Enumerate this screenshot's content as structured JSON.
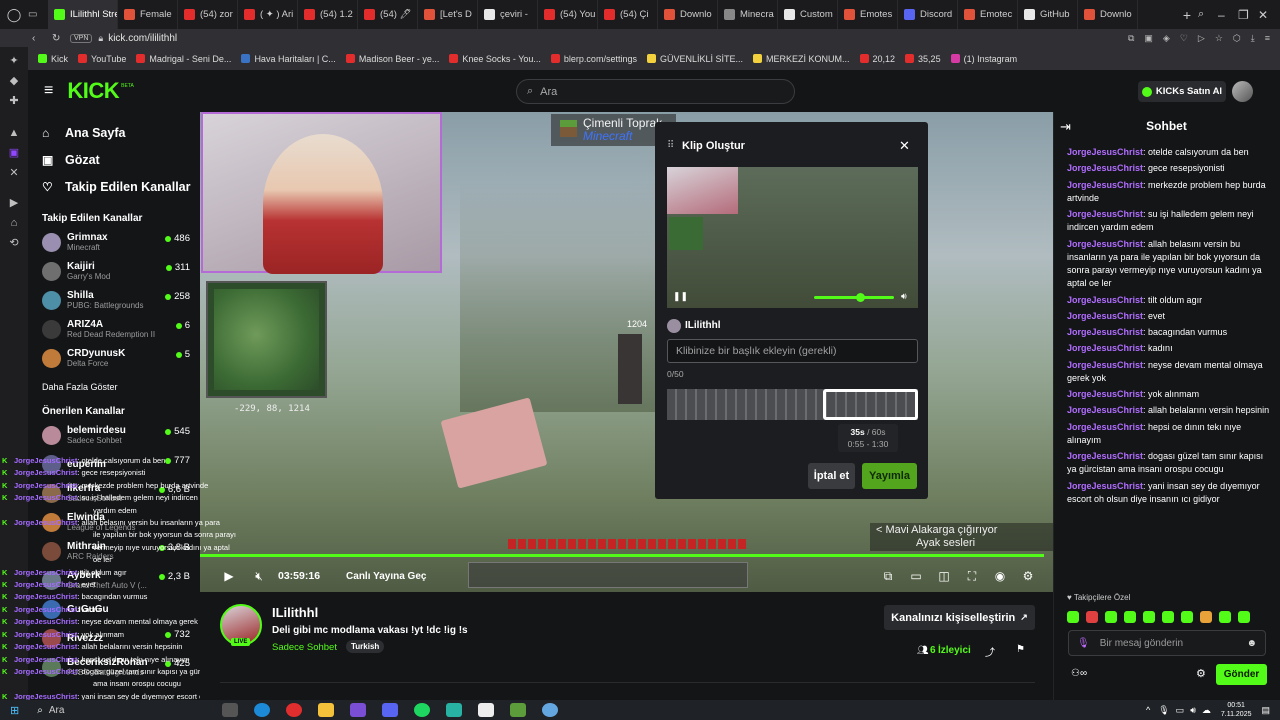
{
  "browser": {
    "tabs": [
      {
        "label": "ILilithhl Stre",
        "color": "#53fc18",
        "active": true
      },
      {
        "label": "Femalе",
        "color": "#e0533a"
      },
      {
        "label": "(54) zor",
        "color": "#e32d2d"
      },
      {
        "label": "( ✦ ) Ari",
        "color": "#e32d2d"
      },
      {
        "label": "(54) 1.2",
        "color": "#e32d2d"
      },
      {
        "label": "(54) 🖊",
        "color": "#e32d2d"
      },
      {
        "label": "[Let's D",
        "color": "#e0533a"
      },
      {
        "label": "çeviri -",
        "color": "#e8e8e8"
      },
      {
        "label": "(54) You",
        "color": "#e32d2d"
      },
      {
        "label": "(54) Çi",
        "color": "#e32d2d"
      },
      {
        "label": "Downlo",
        "color": "#e0533a"
      },
      {
        "label": "Minecra",
        "color": "#888888"
      },
      {
        "label": "Custom",
        "color": "#e8e8e8"
      },
      {
        "label": "Emotes",
        "color": "#e0533a"
      },
      {
        "label": "Discord",
        "color": "#5865f2"
      },
      {
        "label": "Emotec",
        "color": "#e0533a"
      },
      {
        "label": "GitHub",
        "color": "#e8e8e8"
      },
      {
        "label": "Downlo",
        "color": "#e0533a"
      }
    ],
    "vpn": "VPN",
    "url": "kick.com/ililithhl",
    "bookmarks": [
      {
        "label": "Kick",
        "color": "#53fc18"
      },
      {
        "label": "YouTube",
        "color": "#e32d2d"
      },
      {
        "label": "Madrigal - Seni De...",
        "color": "#e32d2d"
      },
      {
        "label": "Hava Haritaları | C...",
        "color": "#3a73c4"
      },
      {
        "label": "Madison Beer - ye...",
        "color": "#e32d2d"
      },
      {
        "label": "Knee Socks - You...",
        "color": "#e32d2d"
      },
      {
        "label": "blerp.com/settings",
        "color": "#e32d2d"
      },
      {
        "label": "GÜVENLİKLİ SİTE...",
        "color": "#f3d03e"
      },
      {
        "label": "MERKEZİ KONUM...",
        "color": "#f3d03e"
      },
      {
        "label": "20,12",
        "color": "#e32d2d"
      },
      {
        "label": "35,25",
        "color": "#e32d2d"
      },
      {
        "label": "(1) Instagram",
        "color": "#d63aa5"
      }
    ]
  },
  "kick": {
    "logo": "KICK",
    "beta": "BETA",
    "search_placeholder": "Ara",
    "buy_kicks": "KICKs Satın Al"
  },
  "sidebar": {
    "nav": [
      {
        "label": "Ana Sayfa",
        "icon": "home-icon"
      },
      {
        "label": "Gözat",
        "icon": "browse-icon"
      },
      {
        "label": "Takip Edilen Kanallar",
        "icon": "heart-icon"
      }
    ],
    "followed_title": "Takip Edilen Kanallar",
    "followed": [
      {
        "name": "Grimnax",
        "game": "Minecraft",
        "viewers": "486",
        "color": "#9a8fb0"
      },
      {
        "name": "Kaijiri",
        "game": "Garry's Mod",
        "viewers": "311",
        "color": "#6f6f6f"
      },
      {
        "name": "Shilla",
        "game": "PUBG: Battlegrounds",
        "viewers": "258",
        "color": "#4d8fa7"
      },
      {
        "name": "ARIZ4A",
        "game": "Red Dead Redemption II",
        "viewers": "6",
        "color": "#3a3a3a"
      },
      {
        "name": "CRDyunusK",
        "game": "Delta Force",
        "viewers": "5",
        "color": "#c07b3b"
      }
    ],
    "show_more": "Daha Fazla Göster",
    "recommended_title": "Önerilen Kanallar",
    "recommended": [
      {
        "name": "belemirdesu",
        "game": "Sadece Sohbet",
        "viewers": "545",
        "color": "#b98a9a"
      },
      {
        "name": "euperim",
        "game": "",
        "viewers": "777",
        "color": "#5e5e8a"
      },
      {
        "name": "ilkerfra",
        "game": "Sadece Sohbet",
        "viewers": "6,6 B",
        "color": "#8a6a4a"
      },
      {
        "name": "Elwinda",
        "game": "League of Legends",
        "viewers": "",
        "color": "#c07b3b"
      },
      {
        "name": "Mithrain",
        "game": "ARC Raiders",
        "viewers": "3,8 B",
        "color": "#7a4a3a"
      },
      {
        "name": "Ayberk",
        "game": "Grand Theft Auto V (...",
        "viewers": "2,3 B",
        "color": "#6a7a8a"
      },
      {
        "name": "GuGuGu",
        "game": "",
        "viewers": "",
        "color": "#3a6ab0"
      },
      {
        "name": "Rivezzz",
        "game": "",
        "viewers": "732",
        "color": "#9a4a4a"
      },
      {
        "name": "BeceriksizRonan",
        "game": "PUBG: Battlegrounds",
        "viewers": "425",
        "color": "#5a7a5a"
      }
    ]
  },
  "overlay_chat": [
    {
      "user": "JorgeJesusChrist",
      "text": "otelde calsıyorum da ben"
    },
    {
      "user": "JorgeJesusChrist",
      "text": "gece resepsiyonisti"
    },
    {
      "user": "JorgeJesusChrist",
      "text": "merkezde problem hep burda artvinde"
    },
    {
      "user": "JorgeJesusChrist",
      "text": "su işi halledem gelem neyi indircen"
    },
    {
      "user": "",
      "text": "yardım edem"
    },
    {
      "user": "JorgeJesusChrist",
      "text": "allah belasını versin bu insanların ya para"
    },
    {
      "user": "",
      "text": "ile yapılan bir bok yıyorsun da sonra parayı"
    },
    {
      "user": "",
      "text": "vermeyip nıye vuruyorsun kadını ya aptal"
    },
    {
      "user": "",
      "text": "oe ler"
    },
    {
      "user": "JorgeJesusChrist",
      "text": "tilt oldum agır"
    },
    {
      "user": "JorgeJesusChrist",
      "text": "evet"
    },
    {
      "user": "JorgeJesusChrist",
      "text": "bacagından vurmus"
    },
    {
      "user": "JorgeJesusChrist",
      "text": "kadını"
    },
    {
      "user": "JorgeJesusChrist",
      "text": "neyse devam mental olmaya gerek yok"
    },
    {
      "user": "JorgeJesusChrist",
      "text": "yok alınmam"
    },
    {
      "user": "JorgeJesusChrist",
      "text": "allah belalarını versin hepsinin"
    },
    {
      "user": "JorgeJesusChrist",
      "text": "hepsi oe dının tekı nıye alınayım"
    },
    {
      "user": "JorgeJesusChrist",
      "text": "dogası güzel tam sınır kapısı ya gürcistan"
    },
    {
      "user": "",
      "text": "ama insanı orospu cocugu"
    },
    {
      "user": "JorgeJesusChrist",
      "text": "yani insan sey de dıyemıyor escort oh"
    },
    {
      "user": "",
      "text": "olsun diye insanın ıcı gidiyor"
    }
  ],
  "game": {
    "badge_title": "Çimenli Toprak",
    "badge_sub": "Minecraft",
    "coords": "-229, 88, 1214",
    "notify_1": "< Mavi Alakarga çığırıyor",
    "notify_2": "Ayak sesleri",
    "overlay_num": "1204"
  },
  "player": {
    "time": "03:59:16",
    "live_btn": "Canlı Yayına Geç",
    "progress_pct": 99
  },
  "clip": {
    "title": "Klip Oluştur",
    "channel": "ILilithhl",
    "title_placeholder": "Klibinize bir başlık ekleyin (gerekli)",
    "char_count": "0/50",
    "duration": "35s",
    "duration_max": "/ 60s",
    "range": "0:55 - 1:30",
    "cancel": "İptal et",
    "publish": "Yayımla",
    "selection_start_pct": 62,
    "selection_width_pct": 38
  },
  "stream": {
    "channel": "ILilithhl",
    "title": "Deli gibi mc modlama vakası !yt !dc !ig !s",
    "category": "Sadece Sohbet",
    "language": "Turkish",
    "live": "LIVE",
    "viewers": "6",
    "viewers_label": "İzleyici",
    "customize": "Kanalınızı kişiselleştirin"
  },
  "chat": {
    "title": "Sohbet",
    "messages": [
      {
        "user": "JorgeJesusChrist",
        "text": "otelde calsıyorum da ben"
      },
      {
        "user": "JorgeJesusChrist",
        "text": "gece resepsiyonisti"
      },
      {
        "user": "JorgeJesusChrist",
        "text": "merkezde problem hep burda artvinde"
      },
      {
        "user": "JorgeJesusChrist",
        "text": "su işi halledem gelem neyi indircen yardım edem"
      },
      {
        "user": "JorgeJesusChrist",
        "text": "allah belasını versin bu insanların ya para ile yapılan bir bok yıyorsun da sonra parayı vermeyip nıye vuruyorsun kadını ya aptal oe ler"
      },
      {
        "user": "JorgeJesusChrist",
        "text": "tilt oldum agır"
      },
      {
        "user": "JorgeJesusChrist",
        "text": "evet"
      },
      {
        "user": "JorgeJesusChrist",
        "text": "bacagından vurmus"
      },
      {
        "user": "JorgeJesusChrist",
        "text": "kadını"
      },
      {
        "user": "JorgeJesusChrist",
        "text": "neyse devam mental olmaya gerek yok"
      },
      {
        "user": "JorgeJesusChrist",
        "text": "yok alınmam"
      },
      {
        "user": "JorgeJesusChrist",
        "text": "allah belalarını versin hepsinin"
      },
      {
        "user": "JorgeJesusChrist",
        "text": "hepsi oe dının tekı nıye alınayım"
      },
      {
        "user": "JorgeJesusChrist",
        "text": "dogası güzel tam sınır kapısı ya gürcistan ama insanı orospu cocugu"
      },
      {
        "user": "JorgeJesusChrist",
        "text": "yani insan sey de dıyemıyor escort oh olsun diye insanın ıcı gidiyor"
      }
    ],
    "followers_only": "Takipçilere Özel",
    "input_placeholder": "Bir mesaj gönderin",
    "send": "Gönder"
  },
  "taskbar": {
    "search": "Ara",
    "time": "00:51",
    "date": "7.11.2025"
  },
  "colors": {
    "accent": "#53fc18",
    "bg": "#141517",
    "username": "#b06dff"
  }
}
